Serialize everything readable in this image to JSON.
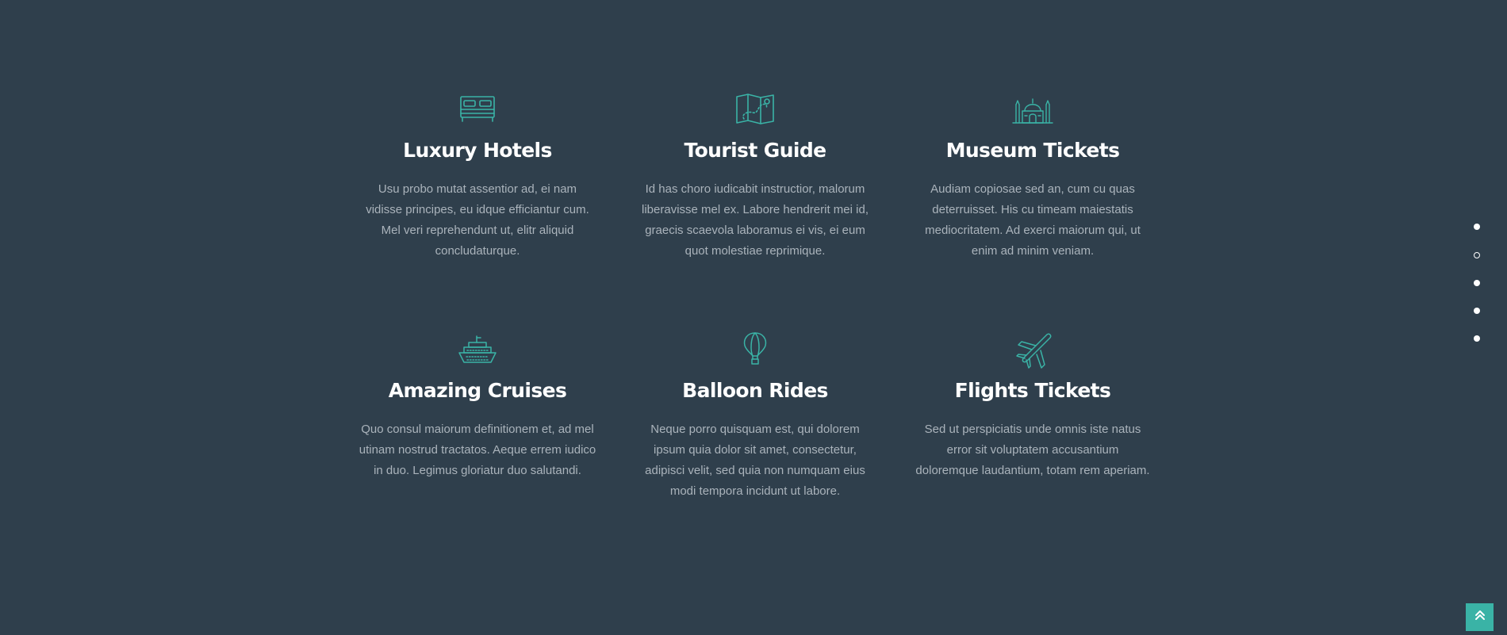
{
  "colors": {
    "background": "#2f3f4c",
    "accent": "#3ab3a6",
    "title": "#ffffff",
    "text": "#aab3bb",
    "dots": "#ffffff"
  },
  "features": [
    {
      "icon": "bed-icon",
      "title": "Luxury Hotels",
      "description": "Usu probo mutat assentior ad, ei nam vidisse principes, eu idque efficiantur cum. Mel veri reprehendunt ut, elitr aliquid concludaturque."
    },
    {
      "icon": "map-icon",
      "title": "Tourist Guide",
      "description": "Id has choro iudicabit instructior, malorum liberavisse mel ex. Labore hendrerit mei id, graecis scaevola laboramus ei vis, ei eum quot molestiae reprimique."
    },
    {
      "icon": "mosque-icon",
      "title": "Museum Tickets",
      "description": "Audiam copiosae sed an, cum cu quas deterruisset. His cu timeam maiestatis mediocritatem. Ad exerci maiorum qui, ut enim ad minim veniam."
    },
    {
      "icon": "cruise-ship-icon",
      "title": "Amazing Cruises",
      "description": "Quo consul maiorum definitionem et, ad mel utinam nostrud tractatos. Aeque errem iudico in duo. Legimus gloriatur duo salutandi."
    },
    {
      "icon": "hot-air-balloon-icon",
      "title": "Balloon Rides",
      "description": "Neque porro quisquam est, qui dolorem ipsum quia dolor sit amet, consectetur, adipisci velit, sed quia non numquam eius modi tempora incidunt ut labore."
    },
    {
      "icon": "airplane-icon",
      "title": "Flights Tickets",
      "description": "Sed ut perspiciatis unde omnis iste natus error sit voluptatem accusantium doloremque laudantium, totam rem aperiam."
    }
  ],
  "side_navigation": {
    "count": 5,
    "active_index": 1
  },
  "back_to_top": {
    "icon": "double-chevron-up-icon"
  }
}
